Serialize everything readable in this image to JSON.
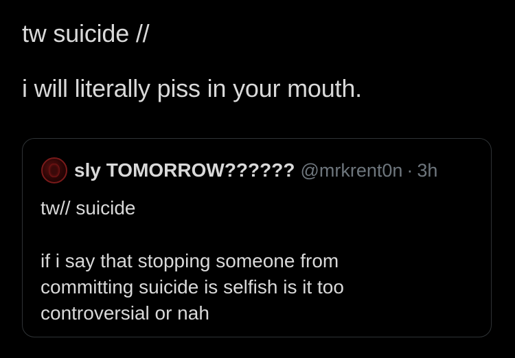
{
  "tweet": {
    "lines": [
      "tw suicide //",
      "i will literally piss in your mouth."
    ]
  },
  "quote": {
    "display_name": "sly TOMORROW??????",
    "handle": "@mrkrent0n",
    "separator": "·",
    "time": "3h",
    "avatar_icon": "profile-avatar-icon",
    "lines": [
      "tw// suicide",
      "if i say that stopping someone from",
      "committing suicide is selfish is it too",
      "controversial or nah"
    ]
  },
  "colors": {
    "background": "#000000",
    "text": "#d9d9d9",
    "secondary_text": "#6e767d",
    "border": "#2f3336"
  }
}
